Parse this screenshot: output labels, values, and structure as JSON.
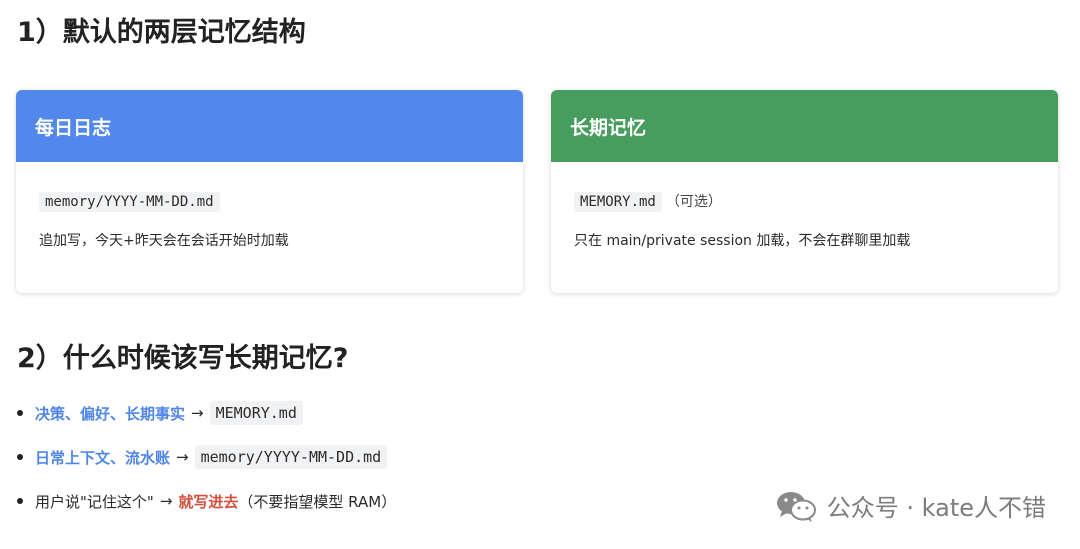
{
  "section1": {
    "title": "1）默认的两层记忆结构"
  },
  "cards": {
    "daily": {
      "title": "每日日志",
      "code": "memory/YYYY-MM-DD.md",
      "description": "追加写，今天+昨天会在会话开始时加载",
      "color": "#5288ec"
    },
    "long": {
      "title": "长期记忆",
      "code": "MEMORY.md",
      "note": "（可选）",
      "description": "只在 main/private session 加载，不会在群聊里加载",
      "color": "#469d5e"
    }
  },
  "section2": {
    "title": "2）什么时候该写长期记忆?",
    "bullets": [
      {
        "highlight": "决策、偏好、长期事实",
        "arrow": "→",
        "target": "MEMORY.md"
      },
      {
        "highlight": "日常上下文、流水账",
        "arrow": "→",
        "target": "memory/YYYY-MM-DD.md"
      },
      {
        "prefix": "用户说\"记住这个\"",
        "arrow": "→",
        "highlight": "就写进去",
        "suffix": "（不要指望模型 RAM）"
      }
    ]
  },
  "watermark": {
    "icon": "wechat-icon",
    "text": "公众号 · kate人不错"
  },
  "colors": {
    "blue_highlight": "#4f86e8",
    "red_highlight": "#d2503c"
  }
}
